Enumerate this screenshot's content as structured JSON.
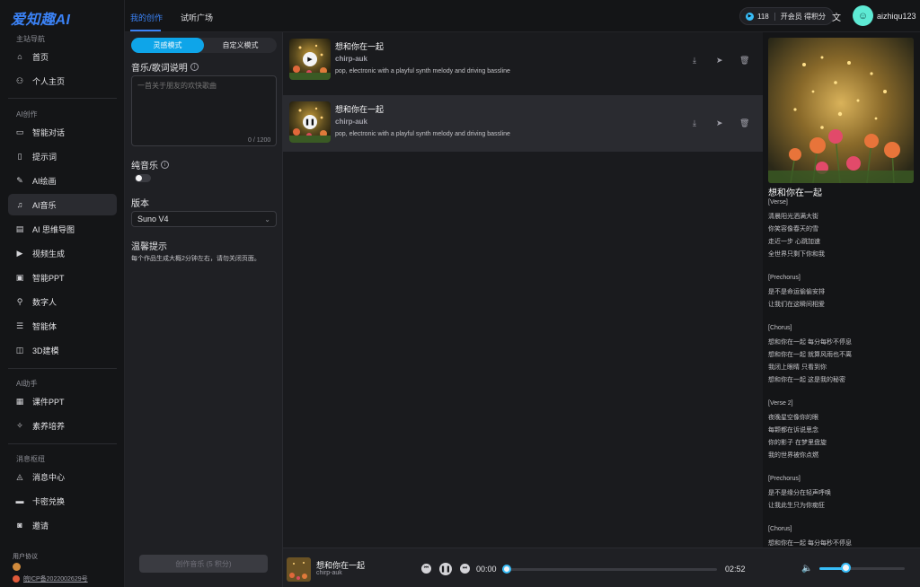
{
  "logo": "爱知趣AI",
  "sidebar": {
    "section_main": "主站导航",
    "main_items": [
      {
        "label": "首页",
        "icon": "home-icon"
      },
      {
        "label": "个人主页",
        "icon": "user-icon"
      }
    ],
    "section_ai": "AI创作",
    "ai_items": [
      {
        "label": "智能对话",
        "icon": "chat-icon"
      },
      {
        "label": "提示词",
        "icon": "bookmark-icon"
      },
      {
        "label": "AI绘画",
        "icon": "brush-icon"
      },
      {
        "label": "AI音乐",
        "icon": "music-icon",
        "active": true
      },
      {
        "label": "AI 思维导图",
        "icon": "chart-icon"
      },
      {
        "label": "视频生成",
        "icon": "play-icon"
      },
      {
        "label": "智能PPT",
        "icon": "ppt-icon"
      },
      {
        "label": "数字人",
        "icon": "walking-person-icon"
      },
      {
        "label": "智能体",
        "icon": "list-icon"
      },
      {
        "label": "3D建模",
        "icon": "cube-icon"
      }
    ],
    "section_helper": "AI助手",
    "helper_items": [
      {
        "label": "课件PPT",
        "icon": "courseware-icon"
      },
      {
        "label": "素养培养",
        "icon": "sparkle-icon"
      }
    ],
    "section_msg": "消息枢纽",
    "msg_items": [
      {
        "label": "消息中心",
        "icon": "bell-icon"
      },
      {
        "label": "卡密兑换",
        "icon": "card-icon"
      },
      {
        "label": "邀请",
        "icon": "invite-icon"
      }
    ],
    "footer_label": "用户协议",
    "footer_icp": "皖ICP备2022002629号"
  },
  "topbar": {
    "tabs": [
      "我的创作",
      "试听广场"
    ],
    "points_value": "118",
    "points_text": "开会员 得积分",
    "username": "aizhiqu123"
  },
  "form": {
    "mode_active": "灵感模式",
    "mode_alt": "自定义模式",
    "desc_label": "音乐/歌词说明",
    "desc_placeholder": "一首关于朋友的欢快歌曲",
    "counter": "0 / 1200",
    "instrumental_label": "纯音乐",
    "version_label": "版本",
    "version_value": "Suno V4",
    "tip_title": "温馨提示",
    "tip_text": "每个作品生成大概2分钟左右，请勿关闭页面。",
    "create_button": "创作音乐 (5 积分)"
  },
  "songs": [
    {
      "title": "想和你在一起",
      "author": "chirp-auk",
      "desc": "pop, electronic with a playful synth melody and driving bassline",
      "state": "paused"
    },
    {
      "title": "想和你在一起",
      "author": "chirp-auk",
      "desc": "pop, electronic with a playful synth melody and driving bassline",
      "state": "playing"
    }
  ],
  "detail": {
    "title": "想和你在一起",
    "lyrics": [
      "[Verse]",
      "清晨阳光洒满大街",
      "你笑容像春天的雪",
      "走近一步 心跳加速",
      "全世界只剩下你和我",
      "",
      "[Prechorus]",
      "是不是命运偷偷安排",
      "让我们在这瞬间相爱",
      "",
      "[Chorus]",
      "想和你在一起 每分每秒不停息",
      "想和你在一起 就算风雨也不离",
      "我闭上眼睛 只看到你",
      "想和你在一起 这是我的秘密",
      "",
      "[Verse 2]",
      "夜晚星空像你的眼",
      "每颗都在诉说思念",
      "你的影子 在梦里盘旋",
      "我的世界被你点燃",
      "",
      "[Prechorus]",
      "是不是缘分在轻声呼唤",
      "让我此生只为你痴狂",
      "",
      "[Chorus]",
      "想和你在一起 每分每秒不停息"
    ]
  },
  "player": {
    "title": "想和你在一起",
    "author": "chirp-auk",
    "current_time": "00:00",
    "total_time": "02:52",
    "progress": 0,
    "volume": 0.3
  }
}
